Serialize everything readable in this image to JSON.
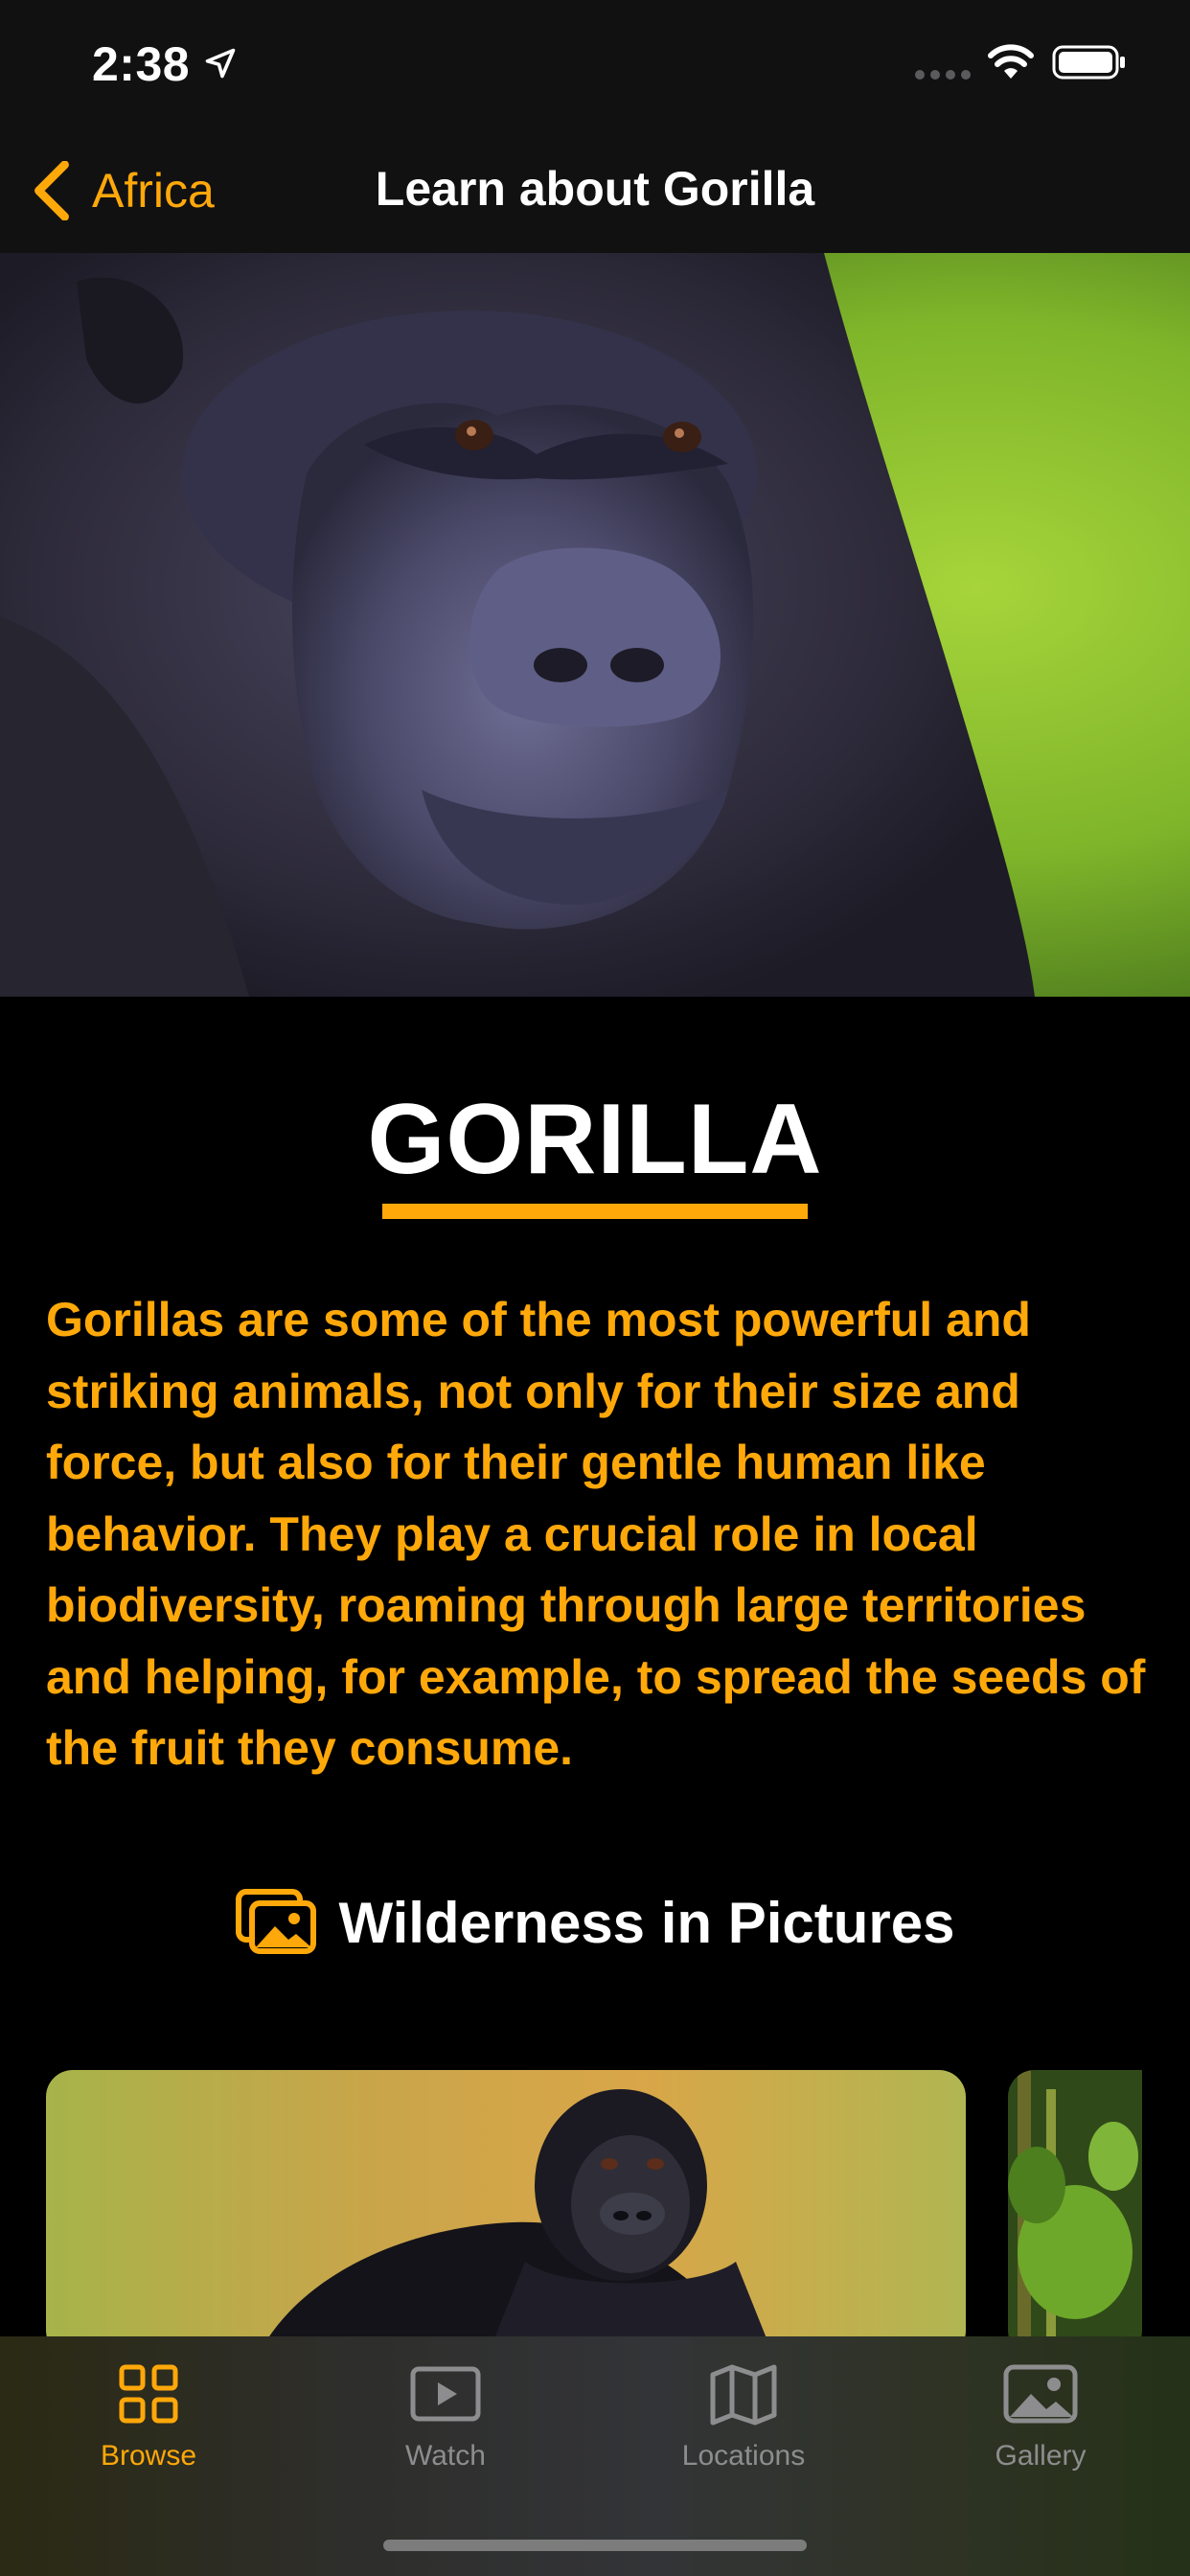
{
  "status_bar": {
    "time": "2:38"
  },
  "nav": {
    "back_label": "Africa",
    "title": "Learn about Gorilla"
  },
  "animal": {
    "name": "GORILLA",
    "description": "Gorillas are some of the most powerful and striking animals, not only for their size and force, but also for their gentle human like behavior. They play a crucial role in local biodiversity, roaming through large territories and helping, for example, to spread the seeds of the fruit they consume."
  },
  "gallery_section": {
    "title": "Wilderness in Pictures",
    "icon": "photos-icon"
  },
  "tab_bar": {
    "tabs": [
      {
        "label": "Browse",
        "icon": "grid-icon",
        "active": true
      },
      {
        "label": "Watch",
        "icon": "play-icon",
        "active": false
      },
      {
        "label": "Locations",
        "icon": "map-icon",
        "active": false
      },
      {
        "label": "Gallery",
        "icon": "photo-icon",
        "active": false
      }
    ]
  },
  "colors": {
    "accent": "#FFA80A",
    "background": "#000000",
    "nav_background": "#111112"
  }
}
